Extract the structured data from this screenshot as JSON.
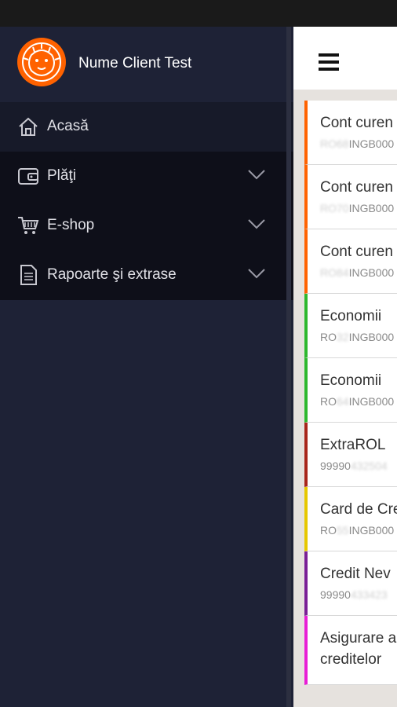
{
  "drawer": {
    "client_name": "Nume Client Test",
    "menu": [
      {
        "label": "Acasă",
        "icon": "home-icon"
      },
      {
        "label": "Plăţi",
        "icon": "wallet-icon"
      },
      {
        "label": "E-shop",
        "icon": "cart-icon"
      },
      {
        "label": "Rapoarte şi extrase",
        "icon": "document-icon"
      }
    ]
  },
  "accounts": [
    {
      "name": "Cont curen",
      "iban_visible": "INGB000",
      "iban_hidden": "RO68",
      "color": "#ff6200"
    },
    {
      "name": "Cont curen",
      "iban_visible": "INGB000",
      "iban_hidden": "RO70",
      "color": "#ff6200"
    },
    {
      "name": "Cont curen",
      "iban_visible": "INGB000",
      "iban_hidden": "RO84",
      "color": "#ff6200"
    },
    {
      "name": "Economii",
      "iban_visible": "RO",
      "iban_visible2": "INGB000",
      "iban_hidden": "32",
      "color": "#2eb82e"
    },
    {
      "name": "Economii",
      "iban_visible": "RO",
      "iban_visible2": "INGB000",
      "iban_hidden": "64",
      "color": "#2eb82e"
    },
    {
      "name": "ExtraROL",
      "iban_visible": "99990",
      "iban_hidden": "432504",
      "color": "#a8251b"
    },
    {
      "name": "Card de Cre",
      "iban_visible": "RO",
      "iban_visible2": "INGB000",
      "iban_hidden": "55",
      "color": "#e6c800"
    },
    {
      "name": "Credit Nev",
      "iban_visible": "99990",
      "iban_hidden": "433423",
      "color": "#7a1f96"
    },
    {
      "name": "Asigurare a",
      "name2": "creditelor",
      "color": "#e81ed6"
    }
  ]
}
